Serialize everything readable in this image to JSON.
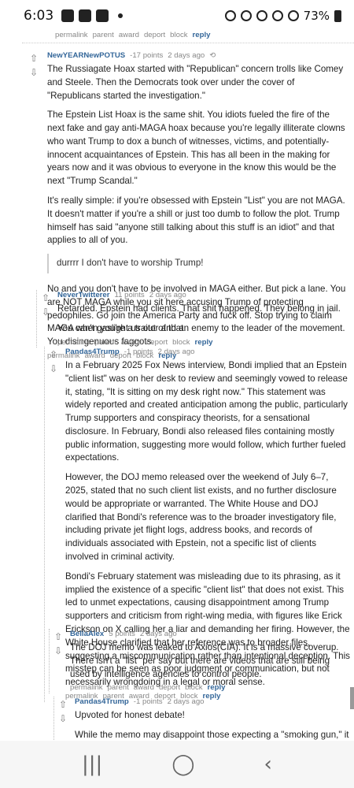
{
  "status": {
    "time": "6:03",
    "battery": "73%"
  },
  "top_links": {
    "permalink": "permalink",
    "parent": "parent",
    "award": "award",
    "deport": "deport",
    "block": "block",
    "reply": "reply"
  },
  "comments": [
    {
      "author": "NewYEARNewPOTUS",
      "points": "-17 points",
      "time": "2 days ago",
      "paragraphs": [
        "The Russiagate Hoax started with \"Republican\" concern trolls like Comey and Steele. Then the Democrats took over under the cover of \"Republicans started the investigation.\"",
        "The Epstein List Hoax is the same shit. You idiots fueled the fire of the next fake and gay anti-MAGA hoax because you're legally illiterate clowns who want Trump to dox a bunch of witnesses, victims, and potentially-innocent acquaintances of Epstein. This has all been in the making for years now and it was obvious to everyone in the know this would be the next \"Trump Scandal.\"",
        "It's really simple: if you're obsessed with Epstein \"List\" you are not MAGA. It doesn't matter if you're a shill or just too dumb to follow the plot. Trump himself has said \"anyone still talking about this stuff is an idiot\" and that applies to all of you."
      ],
      "quote": "durrrr I don't have to worship Trump!",
      "paragraphs_after": [
        "No and you don't have to be involved in MAGA either. But pick a lane. You are NOT MAGA while you sit here accusing Trump of protecting pedophiles. Go join the America Party and fuck off. Stop trying to claim MAGA when you're a traitor and an enemy to the leader of the movement. You disingenuous faggots."
      ],
      "links": {
        "permalink": "permalink",
        "award": "award",
        "deport": "deport",
        "block": "block",
        "reply": "reply"
      }
    },
    {
      "author": "NeverTwitterer",
      "points": "11 points",
      "time": "2 days ago",
      "paragraphs": [
        "Retarded. Epstein had clients. That shit happened. They belong in jail.",
        "You can't gaslight us out of that."
      ],
      "links": {
        "permalink": "permalink",
        "parent": "parent",
        "award": "award",
        "deport": "deport",
        "block": "block",
        "reply": "reply"
      }
    },
    {
      "author": "Pandas4Trump",
      "points": "-1 points",
      "time": "2 days ago",
      "paragraphs": [
        "In a February 2025 Fox News interview, Bondi implied that an Epstein \"client list\" was on her desk to review and seemingly vowed to release it, stating, \"It is sitting on my desk right now.\" This statement was widely reported and created anticipation among the public, particularly Trump supporters and conspiracy theorists, for a sensational disclosure. In February, Bondi also released files containing mostly public information, suggesting more would follow, which further fueled expectations.",
        "However, the DOJ memo released over the weekend of July 6–7, 2025, stated that no such client list exists, and no further disclosure would be appropriate or warranted. The White House and DOJ clarified that Bondi's reference was to the broader investigatory file, including private jet flight logs, address books, and records of individuals associated with Epstein, not a specific list of clients involved in criminal activity.",
        "Bondi's February statement was misleading due to its phrasing, as it implied the existence of a specific \"client list\" that does not exist. This led to unmet expectations, causing disappointment among Trump supporters and criticism from right-wing media, with figures like Erick Erickson on X calling her a liar and demanding her firing. However, the White House clarified that her reference was to broader files, suggesting a miscommunication rather than intentional deception. This misstep can be seen as poor judgment or communication, but not necessarily wrongdoing in a legal or moral sense."
      ],
      "links": {
        "permalink": "permalink",
        "parent": "parent",
        "award": "award",
        "deport": "deport",
        "block": "block",
        "reply": "reply"
      }
    },
    {
      "author": "BellaAlex",
      "points": "5 points",
      "time": "2 days ago",
      "paragraphs": [
        "The DOJ memo was leaked to Axios(CIA). It is a massive coverup. There isn't a \"list\" per say but there are videos that are still being used by intelligence agencies to control people."
      ],
      "links": {
        "permalink": "permalink",
        "parent": "parent",
        "award": "award",
        "deport": "deport",
        "block": "block",
        "reply": "reply"
      }
    },
    {
      "author": "Pandas4Trump",
      "points": "-1 points",
      "time": "2 days ago",
      "paragraphs": [
        "Upvoted for honest debate!",
        "While the memo may disappoint those expecting a \"smoking gun,\" it clarifies Bondi's reference was to broader files, not a specific list. This"
      ]
    }
  ],
  "nav": {
    "recents": "|||",
    "home": "◯",
    "back": "‹"
  }
}
